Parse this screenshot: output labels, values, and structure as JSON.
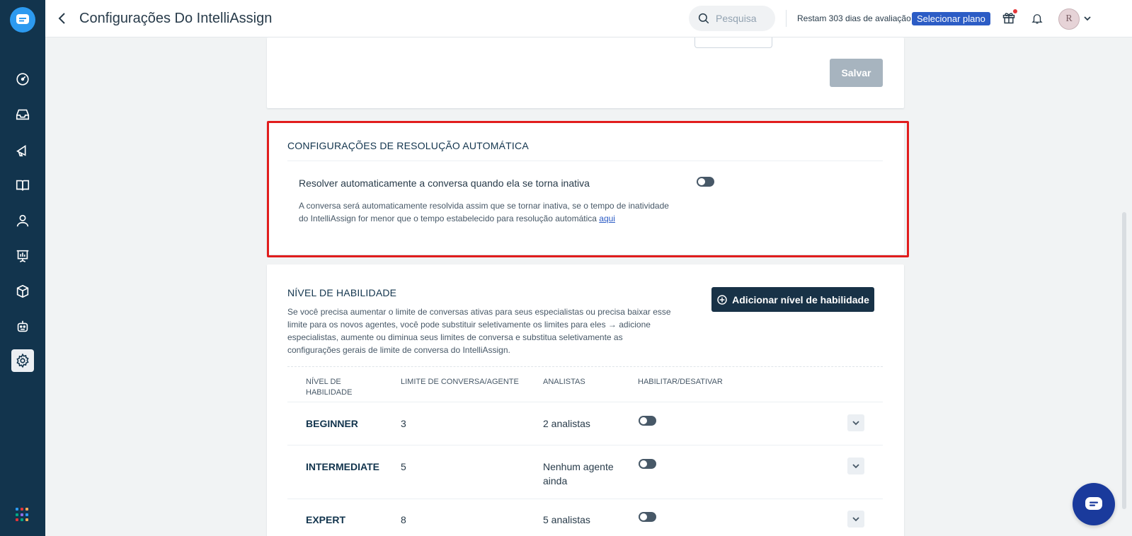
{
  "header": {
    "title": "Configurações Do IntelliAssign",
    "search_placeholder": "Pesquisa",
    "trial_text": "Restam 303 dias de avaliação",
    "plan_button": "Selecionar plano",
    "avatar_initial": "R"
  },
  "top_card": {
    "save_label": "Salvar"
  },
  "auto_resolution": {
    "title": "CONFIGURAÇÕES DE RESOLUÇÃO AUTOMÁTICA",
    "setting_label": "Resolver automaticamente a conversa quando ela se torna inativa",
    "description_line1": "A conversa será automaticamente resolvida assim que se tornar inativa, se o tempo de inatividade",
    "description_line2": "do IntelliAssign for menor que o tempo estabelecido para resolução automática",
    "link_label": "aqui"
  },
  "skill_level": {
    "title": "NÍVEL DE HABILIDADE",
    "description": "Se você precisa aumentar o limite de conversas ativas para seus especialistas ou precisa baixar esse limite para os novos agentes, você pode substituir seletivamente os limites para eles → adicione especialistas, aumente ou diminua seus limites de conversa e substitua seletivamente as configurações gerais de limite de conversa do IntelliAssign.",
    "add_button": "Adicionar nível de habilidade",
    "columns": [
      "NÍVEL DE HABILIDADE",
      "LIMITE DE CONVERSA/AGENTE",
      "ANALISTAS",
      "HABILITAR/DESATIVAR"
    ],
    "rows": [
      {
        "name": "BEGINNER",
        "limit": "3",
        "analysts": "2 analistas"
      },
      {
        "name": "INTERMEDIATE",
        "limit": "5",
        "analysts": "Nenhum agente ainda"
      },
      {
        "name": "EXPERT",
        "limit": "8",
        "analysts": "5 analistas"
      }
    ]
  },
  "colors": {
    "sidebar": "#12344d",
    "accent": "#2c5cc5",
    "highlight": "#e11d1d"
  }
}
